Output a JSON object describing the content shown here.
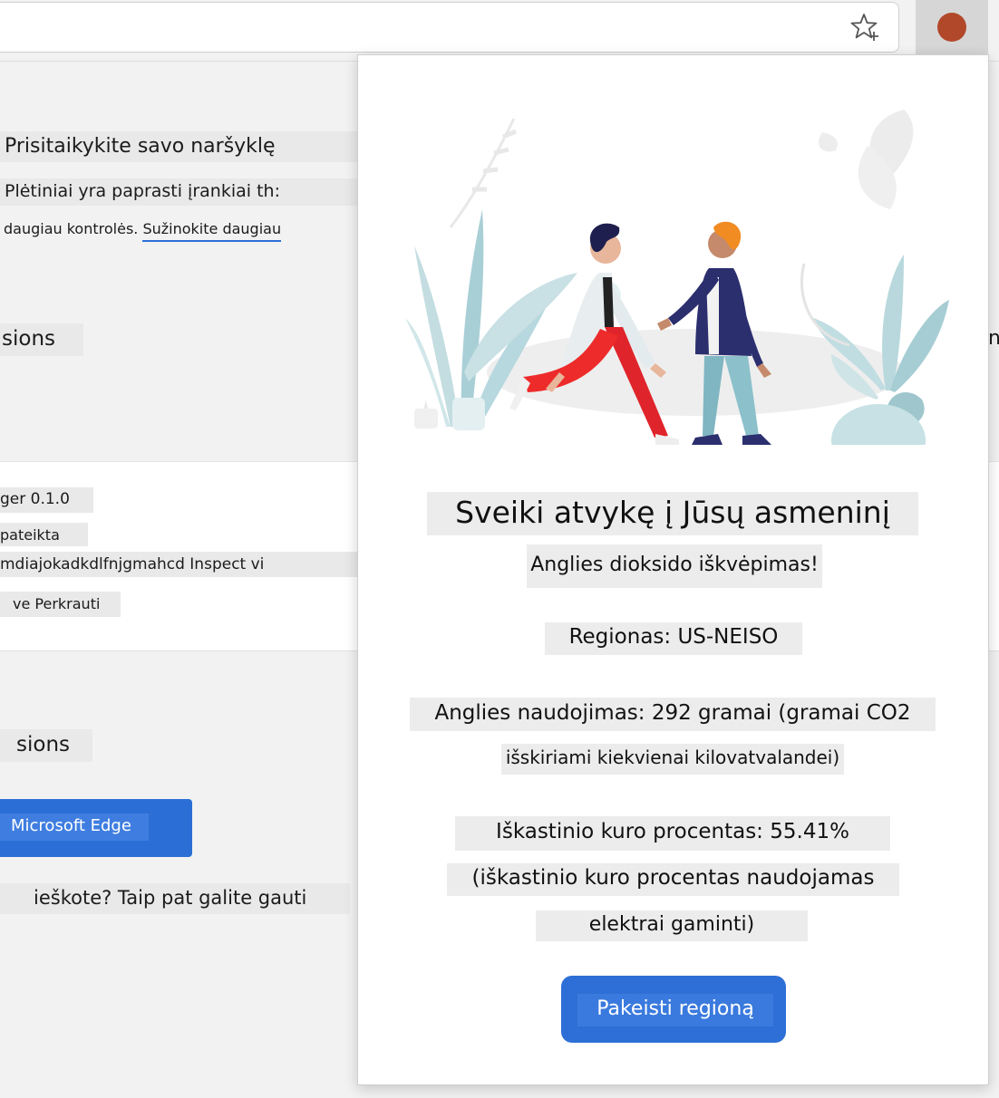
{
  "toolbar": {
    "favorites_icon": "star-add-icon",
    "extension_icon": "extension-dot-icon",
    "extension_color": "#b2482a"
  },
  "background_page": {
    "title": "Prisitaikykite savo naršyklę",
    "paragraph_line1": "Plėtiniai yra paprasti įrankiai th:",
    "paragraph_line2": "daugiau kontrolės.",
    "learn_more_link": "Sužinokite daugiau",
    "section1_heading": "sions",
    "right_edge_fragment": "n",
    "extension_card": {
      "name_version": "ger 0.1.0",
      "status": "pateikta",
      "id_inspect": "mdiajokadkdlfnjgmahcd Inspect vi",
      "actions": "ve Perkrauti"
    },
    "section2_heading": "sions",
    "store_button": "Microsoft Edge",
    "footer_text": "ieškote? Taip pat galite gauti"
  },
  "popup": {
    "title": "Sveiki atvykę į Jūsų asmeninį",
    "subtitle": "Anglies dioksido iškvėpimas!",
    "region": "Regionas: US-NEISO",
    "carbon_line1": "Anglies naudojimas: 292 gramai (gramai CO2",
    "carbon_line2": "išskiriami kiekvienai kilovatvalandei)",
    "fossil_line1": "Iškastinio kuro procentas: 55.41%",
    "fossil_line2": "(iškastinio kuro procentas naudojamas",
    "fossil_line3": "elektrai gaminti)",
    "change_button": "Pakeisti regioną",
    "accent_color": "#2d6fd6"
  }
}
